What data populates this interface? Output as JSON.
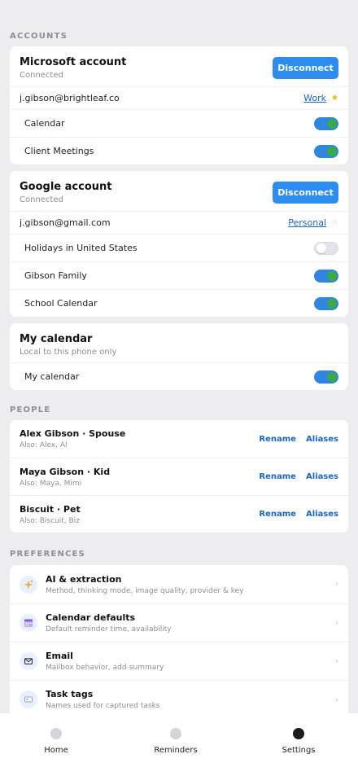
{
  "sections": {
    "accounts": "ACCOUNTS",
    "people": "PEOPLE",
    "preferences": "PREFERENCES"
  },
  "microsoft": {
    "name": "Microsoft account",
    "status": "Connected",
    "button": "Disconnect",
    "email": "j.gibson@brightleaf.co",
    "tag": "Work",
    "star": "★",
    "calendars": [
      {
        "label": "Calendar",
        "enabled": true
      },
      {
        "label": "Client Meetings",
        "enabled": true
      }
    ]
  },
  "google": {
    "name": "Google account",
    "status": "Connected",
    "button": "Disconnect",
    "email": "j.gibson@gmail.com",
    "tag": "Personal",
    "star": "☆",
    "calendars": [
      {
        "label": "Holidays in United States",
        "enabled": false
      },
      {
        "label": "Gibson Family",
        "enabled": true
      },
      {
        "label": "School Calendar",
        "enabled": true
      }
    ]
  },
  "local": {
    "name": "My calendar",
    "subtitle": "Local to this phone only",
    "calendars": [
      {
        "label": "My calendar",
        "enabled": true
      }
    ]
  },
  "people": [
    {
      "name": "Alex Gibson · Spouse",
      "also": "Also: Alex, Al",
      "rename": "Rename",
      "aliases": "Aliases"
    },
    {
      "name": "Maya Gibson · Kid",
      "also": "Also: Maya, Mimi",
      "rename": "Rename",
      "aliases": "Aliases"
    },
    {
      "name": "Biscuit · Pet",
      "also": "Also: Biscuit, Biz",
      "rename": "Rename",
      "aliases": "Aliases"
    }
  ],
  "preferences": [
    {
      "title": "AI & extraction",
      "subtitle": "Method, thinking mode, image quality, provider & key",
      "icon": "sparkle-icon"
    },
    {
      "title": "Calendar defaults",
      "subtitle": "Default reminder time, availability",
      "icon": "calendar-icon"
    },
    {
      "title": "Email",
      "subtitle": "Mailbox behavior, add-summary",
      "icon": "mail-icon"
    },
    {
      "title": "Task tags",
      "subtitle": "Names used for captured tasks",
      "icon": "tag-icon"
    }
  ],
  "chevron": "›",
  "tabs": [
    {
      "label": "Home",
      "active": false
    },
    {
      "label": "Reminders",
      "active": false
    },
    {
      "label": "Settings",
      "active": true
    }
  ],
  "colors": {
    "accent": "#2d8cf0",
    "link": "#1a66c2",
    "toggle_on": "#2f86e0",
    "toggle_knob_on": "#3aaa48",
    "star": "#f0b400",
    "background": "#ededf0"
  }
}
